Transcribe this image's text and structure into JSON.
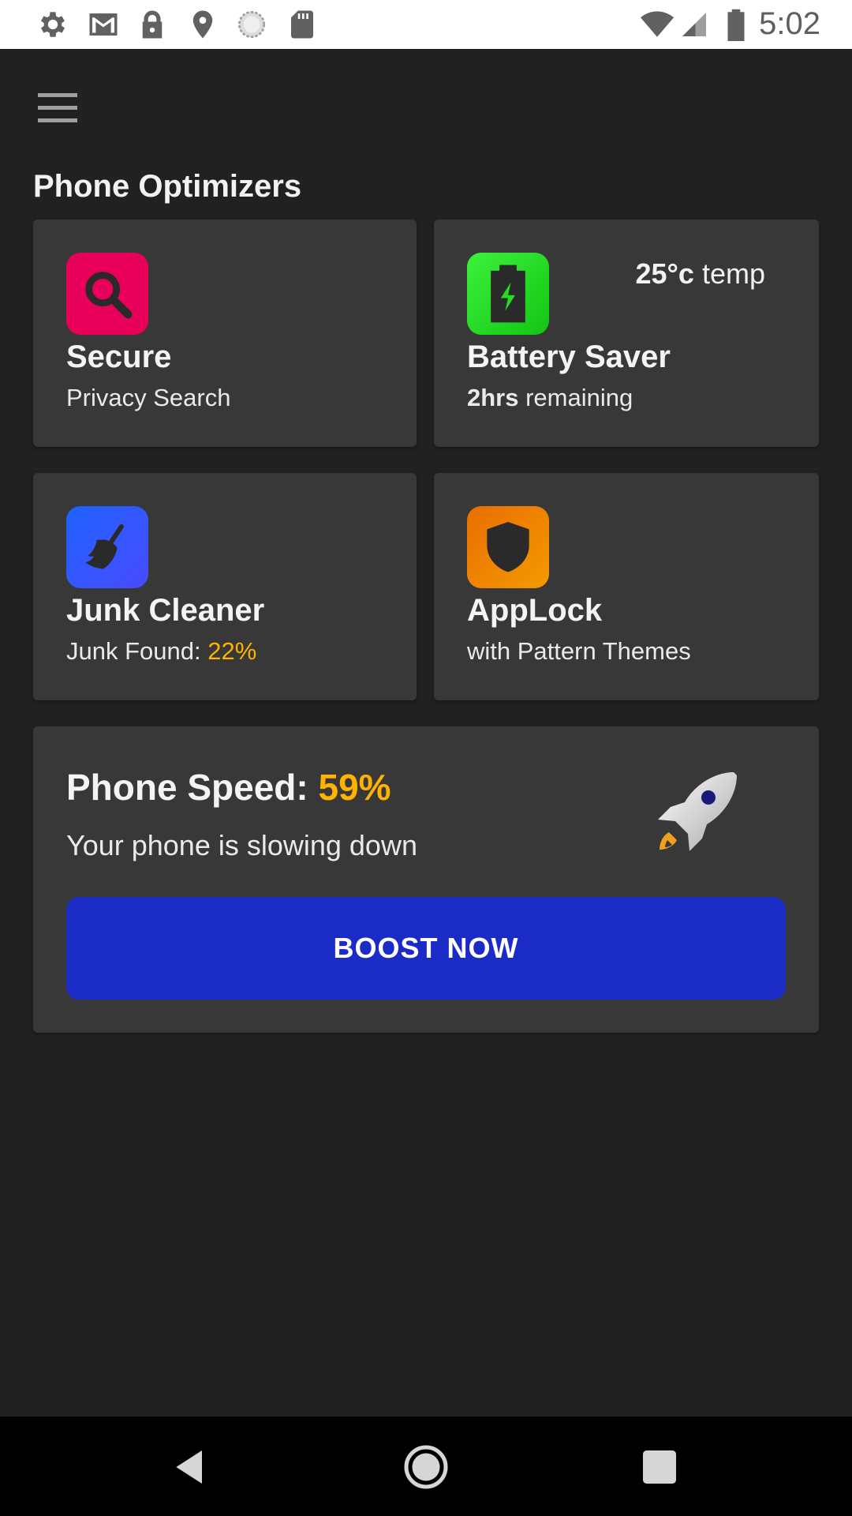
{
  "status_bar": {
    "time": "5:02",
    "left_icons": [
      "settings-icon",
      "gmail-icon",
      "lock-icon",
      "location-icon",
      "sync-icon",
      "sd-card-icon"
    ],
    "right_icons": [
      "wifi-icon",
      "signal-icon",
      "battery-icon"
    ]
  },
  "header": {
    "menu_icon": "hamburger-menu-icon",
    "section_title": "Phone Optimizers"
  },
  "tiles": {
    "secure": {
      "icon": "search-icon",
      "icon_color": "#e8005a",
      "title": "Secure",
      "subtitle": "Privacy Search"
    },
    "battery": {
      "icon": "battery-charging-icon",
      "icon_color": "#1ed61e",
      "title": "Battery Saver",
      "temp_value": "25°c",
      "temp_label": " temp",
      "remaining_value": "2hrs",
      "remaining_label": " remaining"
    },
    "junk": {
      "icon": "broom-icon",
      "icon_color": "#2d5bff",
      "title": "Junk Cleaner",
      "found_label": "Junk Found: ",
      "found_value": "22%"
    },
    "applock": {
      "icon": "shield-icon",
      "icon_color": "#f08000",
      "title": "AppLock",
      "subtitle": "with Pattern Themes"
    }
  },
  "speed": {
    "label": "Phone Speed: ",
    "value": "59%",
    "message": "Your phone is slowing down",
    "icon": "rocket-icon",
    "button_label": "BOOST NOW",
    "accent_color": "#ffb300",
    "button_color": "#1b2bc6"
  },
  "nav_bar": {
    "items": [
      "back-icon",
      "home-icon",
      "recents-icon"
    ]
  }
}
